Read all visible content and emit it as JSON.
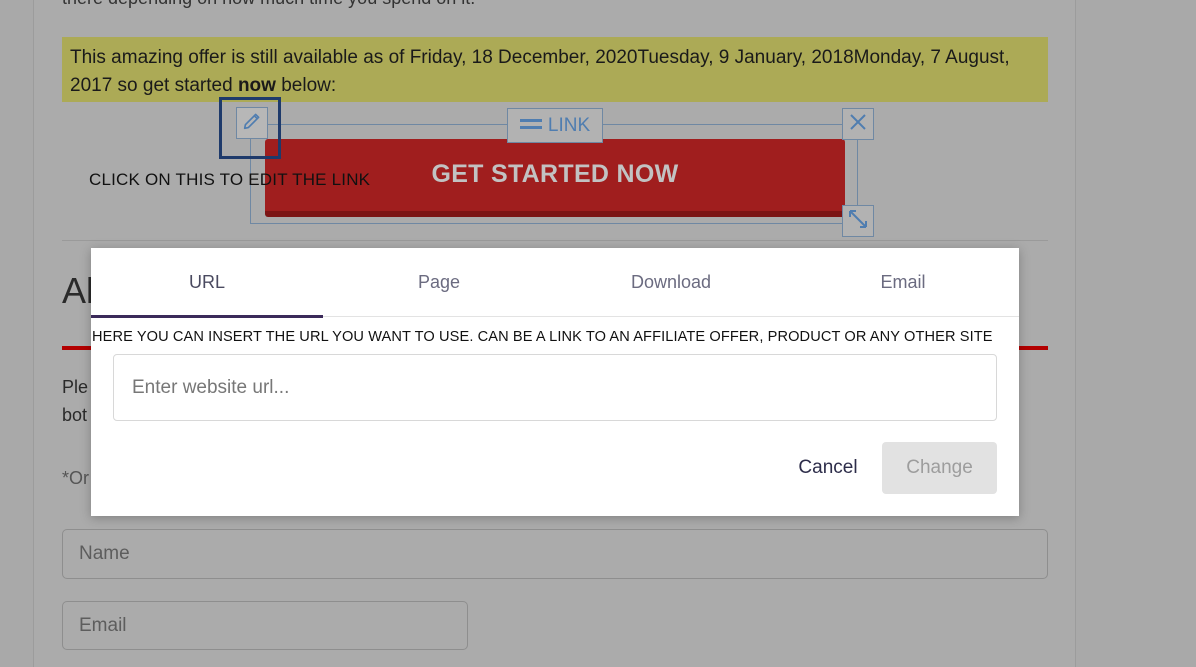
{
  "page": {
    "top_text_fragment": "there depending on how much time you spend on it.",
    "offer": {
      "text_before": "This amazing offer is still available as of Friday, 18 December, 2020Tuesday, 9 January, 2018Monday, 7 August, 2017 so get started ",
      "bold": "now",
      "text_after": " below:"
    },
    "cta": {
      "label": "GET STARTED NOW",
      "link_tag": "LINK"
    },
    "annotation": "CLICK ON THIS TO EDIT THE LINK",
    "heading_fragment": "Al",
    "para_1_fragment": "Ple",
    "para_2_fragment": "bot",
    "para_3_fragment": "*Or",
    "form": {
      "name_placeholder": "Name",
      "email_placeholder": "Email"
    },
    "accent_colors": {
      "offer_highlight": "#acaa56",
      "cta_red": "#a01e1e",
      "edit_highlight": "#1e3a6b",
      "divider_red": "#b30000"
    }
  },
  "modal": {
    "tabs": [
      {
        "label": "URL",
        "active": true
      },
      {
        "label": "Page",
        "active": false
      },
      {
        "label": "Download",
        "active": false
      },
      {
        "label": "Email",
        "active": false
      }
    ],
    "help_text": "HERE YOU CAN INSERT THE URL YOU WANT TO USE. CAN BE A LINK TO AN AFFILIATE OFFER, PRODUCT OR ANY OTHER SITE",
    "url_input": {
      "value": "",
      "placeholder": "Enter website url..."
    },
    "cancel_label": "Cancel",
    "change_label": "Change"
  },
  "icons": {
    "edit": "pencil-icon",
    "link": "drag-handle-icon",
    "close": "close-icon",
    "resize": "resize-icon"
  }
}
